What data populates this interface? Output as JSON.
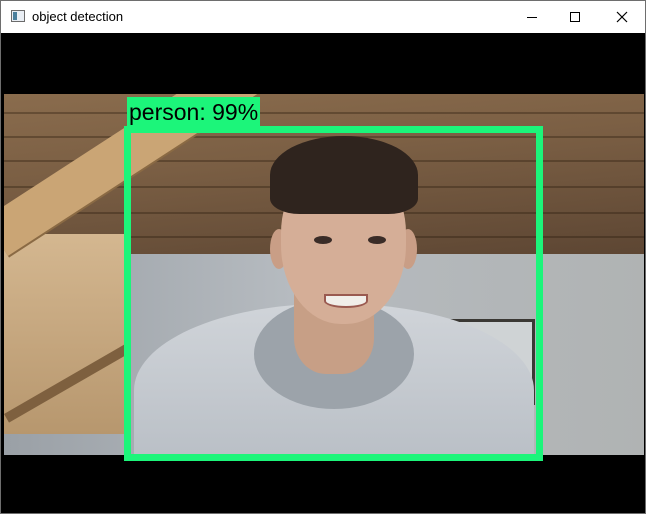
{
  "window": {
    "title": "object detection",
    "controls": {
      "minimize": "minimize-icon",
      "maximize": "maximize-icon",
      "close": "close-icon"
    }
  },
  "detection": {
    "label": "person: 99%",
    "box_color": "#1cf57a"
  }
}
